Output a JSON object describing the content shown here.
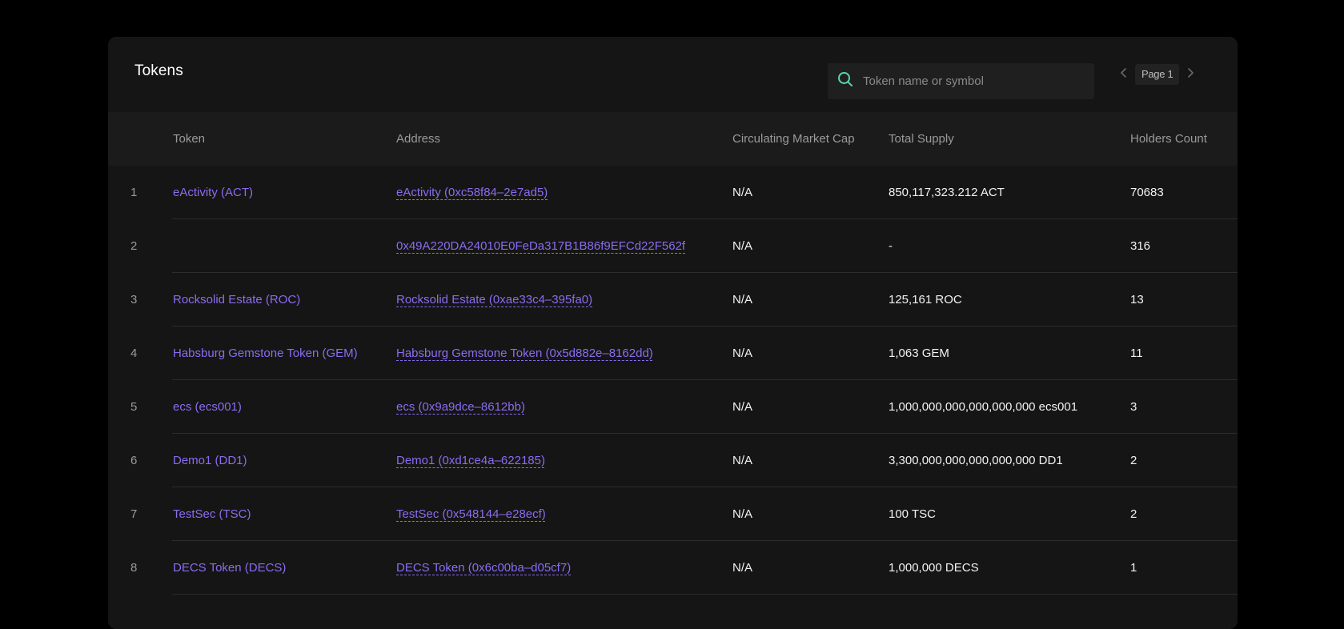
{
  "header": {
    "title": "Tokens",
    "search_placeholder": "Token name or symbol",
    "page_label": "Page 1"
  },
  "columns": {
    "token": "Token",
    "address": "Address",
    "market_cap": "Circulating Market Cap",
    "total_supply": "Total Supply",
    "holders": "Holders Count"
  },
  "rows": [
    {
      "num": "1",
      "token": "eActivity (ACT)",
      "address": "eActivity (0xc58f84–2e7ad5)",
      "market_cap": "N/A",
      "total_supply": "850,117,323.212 ACT",
      "holders": "70683"
    },
    {
      "num": "2",
      "token": "",
      "address": "0x49A220DA24010E0FeDa317B1B86f9EFCd22F562f",
      "market_cap": "N/A",
      "total_supply": "-",
      "holders": "316"
    },
    {
      "num": "3",
      "token": "Rocksolid Estate (ROC)",
      "address": "Rocksolid Estate (0xae33c4–395fa0)",
      "market_cap": "N/A",
      "total_supply": "125,161 ROC",
      "holders": "13"
    },
    {
      "num": "4",
      "token": "Habsburg Gemstone Token (GEM)",
      "address": "Habsburg Gemstone Token (0x5d882e–8162dd)",
      "market_cap": "N/A",
      "total_supply": "1,063 GEM",
      "holders": "11"
    },
    {
      "num": "5",
      "token": "ecs (ecs001)",
      "address": "ecs (0x9a9dce–8612bb)",
      "market_cap": "N/A",
      "total_supply": "1,000,000,000,000,000,000 ecs001",
      "holders": "3"
    },
    {
      "num": "6",
      "token": "Demo1 (DD1)",
      "address": "Demo1 (0xd1ce4a–622185)",
      "market_cap": "N/A",
      "total_supply": "3,300,000,000,000,000,000 DD1",
      "holders": "2"
    },
    {
      "num": "7",
      "token": "TestSec (TSC)",
      "address": "TestSec (0x548144–e28ecf)",
      "market_cap": "N/A",
      "total_supply": "100 TSC",
      "holders": "2"
    },
    {
      "num": "8",
      "token": "DECS Token (DECS)",
      "address": "DECS Token (0x6c00ba–d05cf7)",
      "market_cap": "N/A",
      "total_supply": "1,000,000 DECS",
      "holders": "1"
    }
  ],
  "colors": {
    "background": "#000000",
    "card": "#151515",
    "accent_link": "#8b6cf0",
    "search_icon": "#5ad6a8"
  },
  "icons": {
    "search": "search-icon",
    "prev": "chevron-left-icon",
    "next": "chevron-right-icon"
  }
}
